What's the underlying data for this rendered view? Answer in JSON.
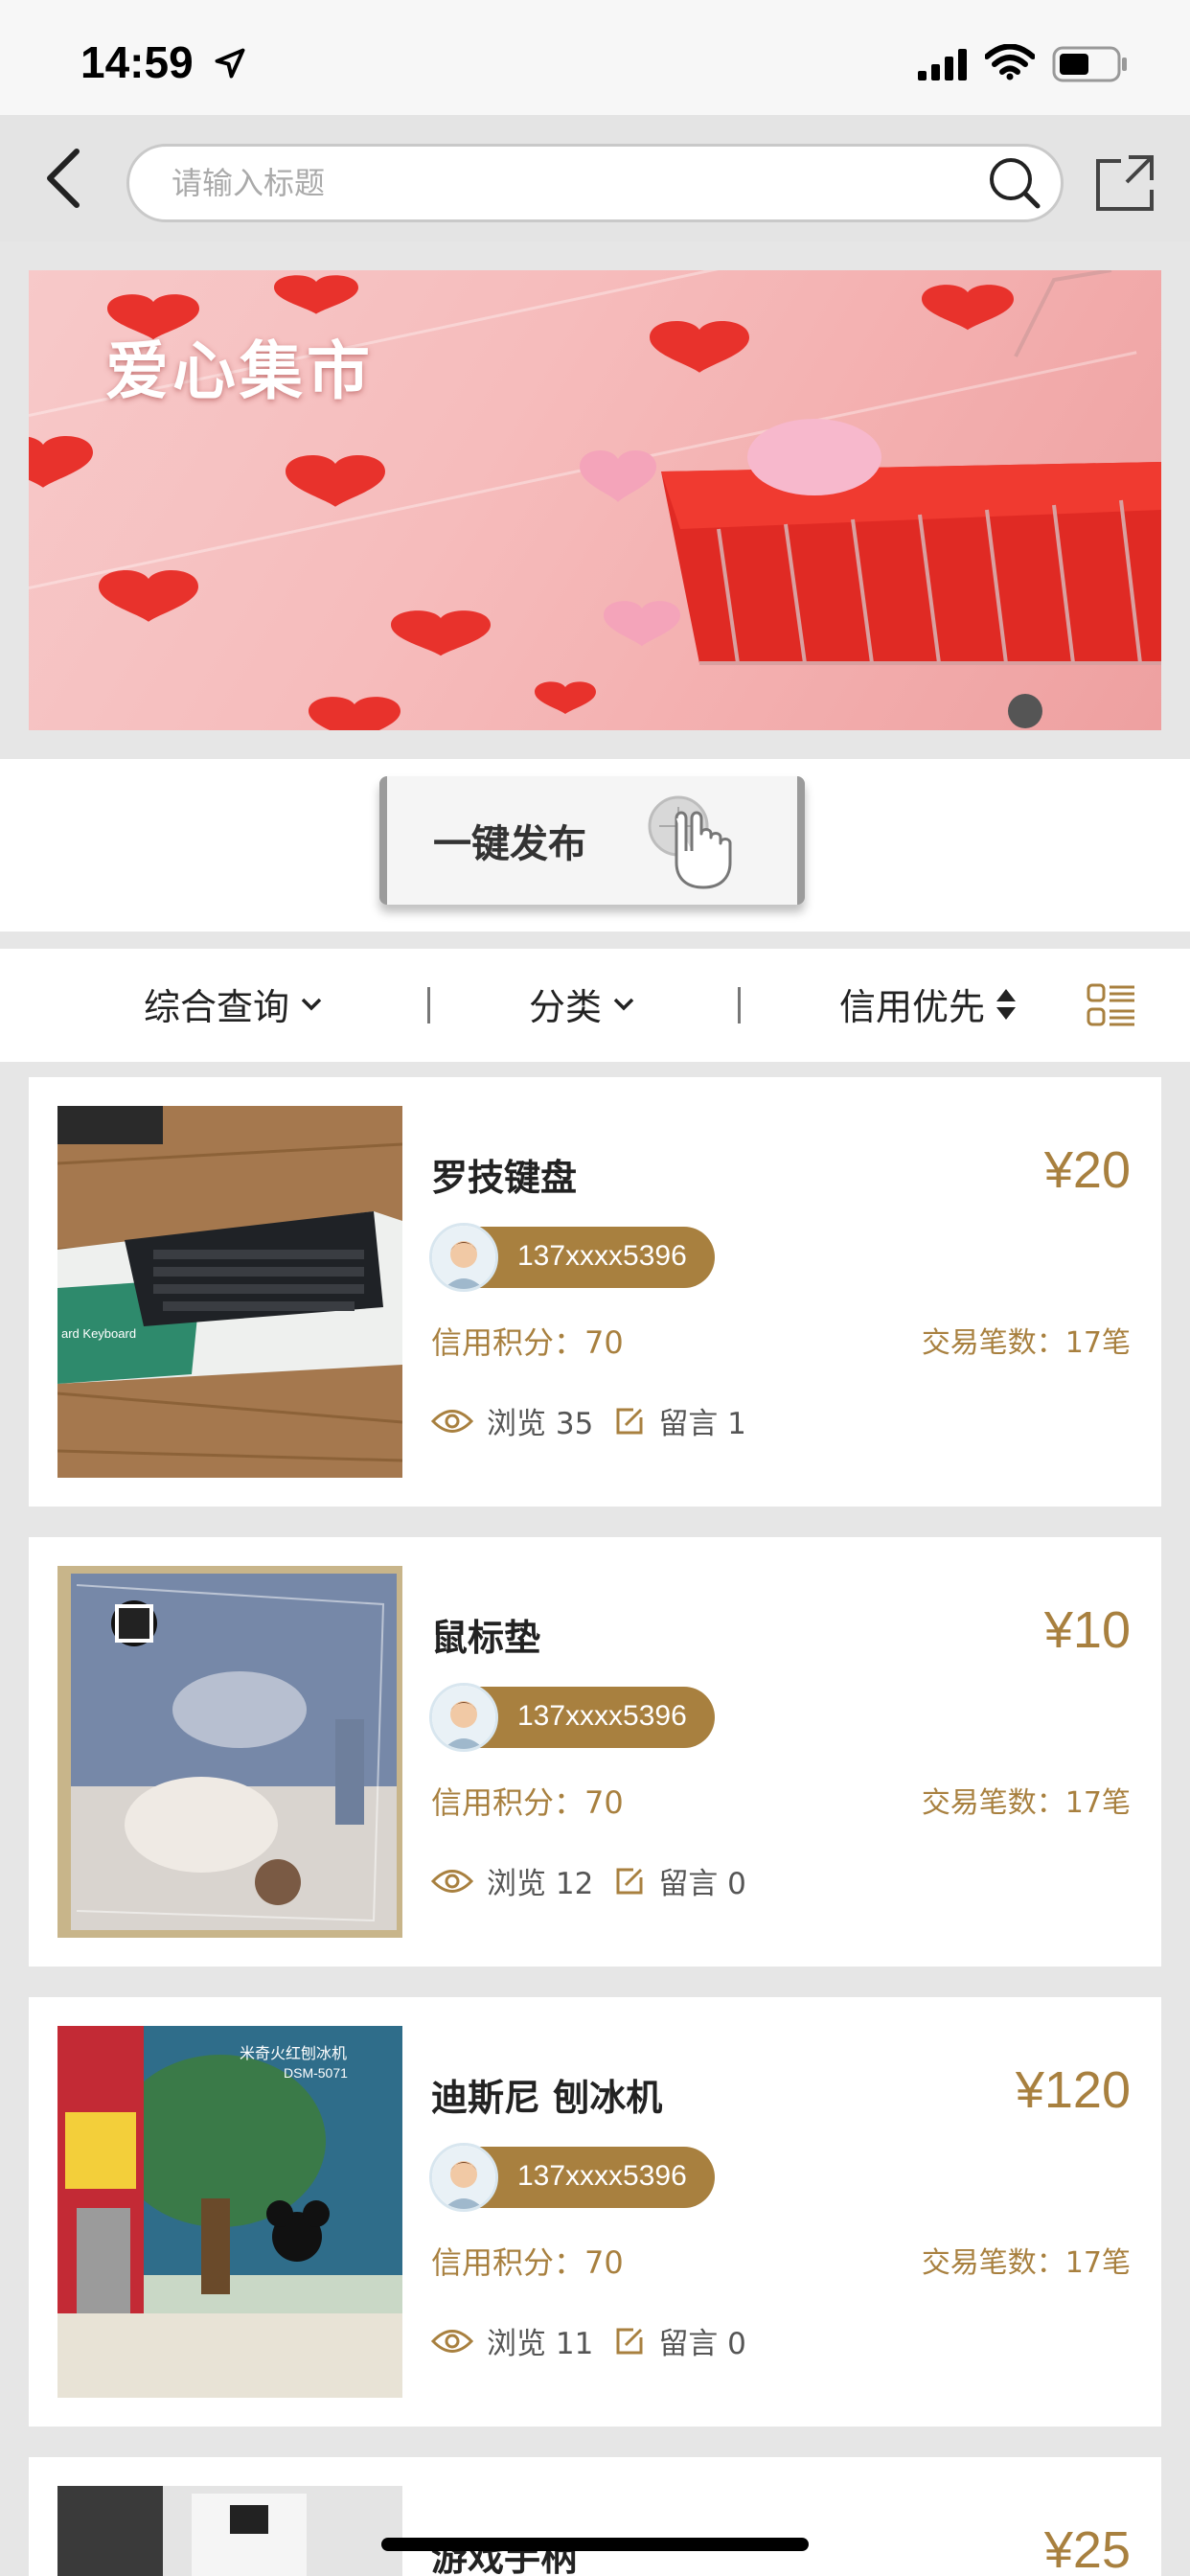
{
  "status_bar": {
    "time": "14:59"
  },
  "nav": {
    "search_placeholder": "请输入标题"
  },
  "banner": {
    "title": "爱心集市"
  },
  "publish": {
    "label": "一键发布"
  },
  "filters": {
    "comprehensive": "综合查询",
    "category": "分类",
    "credit_first": "信用优先"
  },
  "products": [
    {
      "title": "罗技键盘",
      "price": "¥20",
      "seller": "137xxxx5396",
      "credit": "信用积分：70",
      "trades": "交易笔数：17笔",
      "views": "浏览 35",
      "comments": "留言 1"
    },
    {
      "title": "鼠标垫",
      "price": "¥10",
      "seller": "137xxxx5396",
      "credit": "信用积分：70",
      "trades": "交易笔数：17笔",
      "views": "浏览 12",
      "comments": "留言 0"
    },
    {
      "title": "迪斯尼 刨冰机",
      "price": "¥120",
      "seller": "137xxxx5396",
      "credit": "信用积分：70",
      "trades": "交易笔数：17笔",
      "views": "浏览 11",
      "comments": "留言 0"
    },
    {
      "title": "游戏手柄",
      "price": "¥25"
    }
  ],
  "colors": {
    "accent": "#a8803f",
    "background": "#e6e6e6"
  }
}
